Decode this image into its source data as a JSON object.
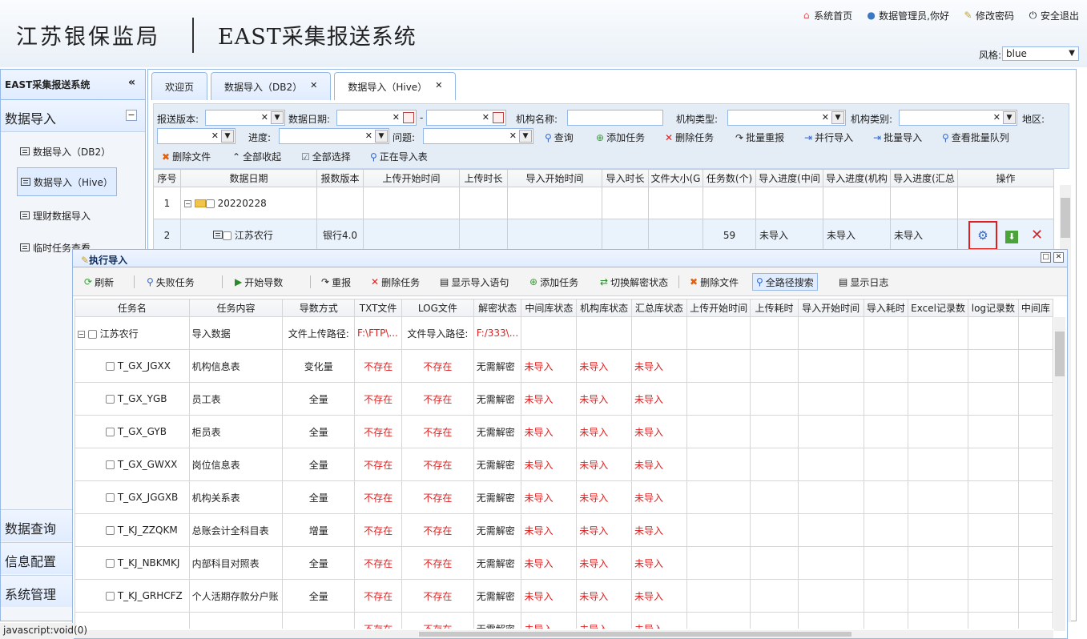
{
  "header": {
    "org": "江苏银保监局",
    "system": "EAST采集报送系统",
    "links": [
      "系统首页",
      "数据管理员,你好",
      "修改密码",
      "安全退出"
    ],
    "style_label": "风格:",
    "style_value": "blue"
  },
  "sidebar": {
    "title": "EAST采集报送系统",
    "section": "数据导入",
    "items": [
      "数据导入（DB2）",
      "数据导入（Hive）",
      "理财数据导入",
      "临时任务查看"
    ],
    "bottom": [
      "数据查询",
      "信息配置",
      "系统管理"
    ]
  },
  "tabs": [
    "欢迎页",
    "数据导入（DB2）",
    "数据导入（Hive）"
  ],
  "filter": {
    "labels": [
      "报送版本:",
      "数据日期:",
      "-",
      "机构名称:",
      "机构类型:",
      "机构类别:",
      "地区:",
      "进度:",
      "问题:"
    ],
    "buttons": [
      "查询",
      "添加任务",
      "删除任务",
      "批量重报",
      "并行导入",
      "批量导入",
      "查看批量队列",
      "删除文件",
      "全部收起",
      "全部选择",
      "正在导入表"
    ]
  },
  "grid": {
    "columns": [
      "序号",
      "数据日期",
      "报数版本",
      "上传开始时间",
      "上传时长",
      "导入开始时间",
      "导入时长",
      "文件大小(G",
      "任务数(个)",
      "导入进度(中间",
      "导入进度(机构",
      "导入进度(汇总",
      "操作"
    ],
    "rows": [
      {
        "no": "1",
        "date": "20220228"
      },
      {
        "no": "2",
        "org": "江苏农行",
        "version": "银行4.0",
        "tasks": "59",
        "p1": "未导入",
        "p2": "未导入",
        "p3": "未导入"
      }
    ]
  },
  "dialog": {
    "title": "执行导入",
    "toolbar": [
      "刷新",
      "失败任务",
      "开始导数",
      "重报",
      "删除任务",
      "显示导入语句",
      "添加任务",
      "切换解密状态",
      "删除文件",
      "全路径搜索",
      "显示日志"
    ],
    "columns": [
      "任务名",
      "任务内容",
      "导数方式",
      "TXT文件",
      "LOG文件",
      "解密状态",
      "中间库状态",
      "机构库状态",
      "汇总库状态",
      "上传开始时间",
      "上传耗时",
      "导入开始时间",
      "导入耗时",
      "Excel记录数",
      "log记录数",
      "中间库"
    ],
    "parent": {
      "name": "江苏农行",
      "content": "导入数据",
      "mode": "文件上传路径:",
      "txt": "F:\\FTP\\...",
      "log": "文件导入路径:",
      "dec": "F:/333\\..."
    },
    "rows": [
      {
        "name": "T_GX_JGXX",
        "content": "机构信息表",
        "mode": "变化量"
      },
      {
        "name": "T_GX_YGB",
        "content": "员工表",
        "mode": "全量"
      },
      {
        "name": "T_GX_GYB",
        "content": "柜员表",
        "mode": "全量"
      },
      {
        "name": "T_GX_GWXX",
        "content": "岗位信息表",
        "mode": "全量"
      },
      {
        "name": "T_GX_JGGXB",
        "content": "机构关系表",
        "mode": "全量"
      },
      {
        "name": "T_KJ_ZZQKM",
        "content": "总账会计全科目表",
        "mode": "增量"
      },
      {
        "name": "T_KJ_NBKMKJ",
        "content": "内部科目对照表",
        "mode": "全量"
      },
      {
        "name": "T_KJ_GRHCFZ",
        "content": "个人活期存款分户账",
        "mode": "全量"
      },
      {
        "name": "",
        "content": "",
        "mode": ""
      }
    ],
    "status_values": {
      "txt": "不存在",
      "log": "不存在",
      "dec": "无需解密",
      "state": "未导入"
    }
  },
  "statusbar": "javascript:void(0)"
}
